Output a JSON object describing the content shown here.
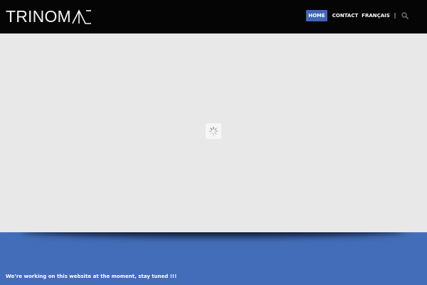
{
  "header": {
    "brand": "TRINOM",
    "brand_accent_color": "#f4f4f4",
    "background": "#050505"
  },
  "nav": {
    "items": [
      {
        "label": "HOME",
        "active": true
      },
      {
        "label": "CONTACT",
        "active": false
      },
      {
        "label": "FRANÇAIS",
        "active": false
      }
    ],
    "active_color": "#4167b5",
    "search_icon": "search-icon"
  },
  "slider": {
    "state": "loading",
    "loader_icon": "spinner-icon",
    "background": "#e8e8e8"
  },
  "footer": {
    "notice": "We’re working on this website at the moment, stay tuned !!!",
    "background": "#436db8"
  }
}
